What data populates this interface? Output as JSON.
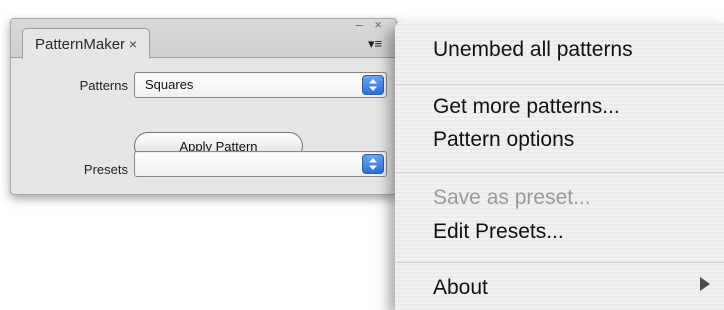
{
  "panel": {
    "tab_label": "PatternMaker",
    "tab_close_glyph": "×",
    "window_controls": "– ×",
    "menu_toggle_glyph": "▾≡",
    "patterns_label": "Patterns",
    "patterns_value": "Squares",
    "apply_button_label": "Apply Pattern",
    "presets_label": "Presets",
    "presets_value": ""
  },
  "menu": {
    "items": [
      {
        "label": "Unembed all patterns",
        "enabled": true
      },
      {
        "label": "Get more patterns...",
        "enabled": true
      },
      {
        "label": "Pattern options",
        "enabled": true
      },
      {
        "label": "Save as preset...",
        "enabled": false
      },
      {
        "label": "Edit Presets...",
        "enabled": true
      },
      {
        "label": "About",
        "enabled": true,
        "has_submenu": true
      }
    ]
  },
  "colors": {
    "accent_blue": "#2e6fd8",
    "disabled_text": "#9a9a9a"
  }
}
